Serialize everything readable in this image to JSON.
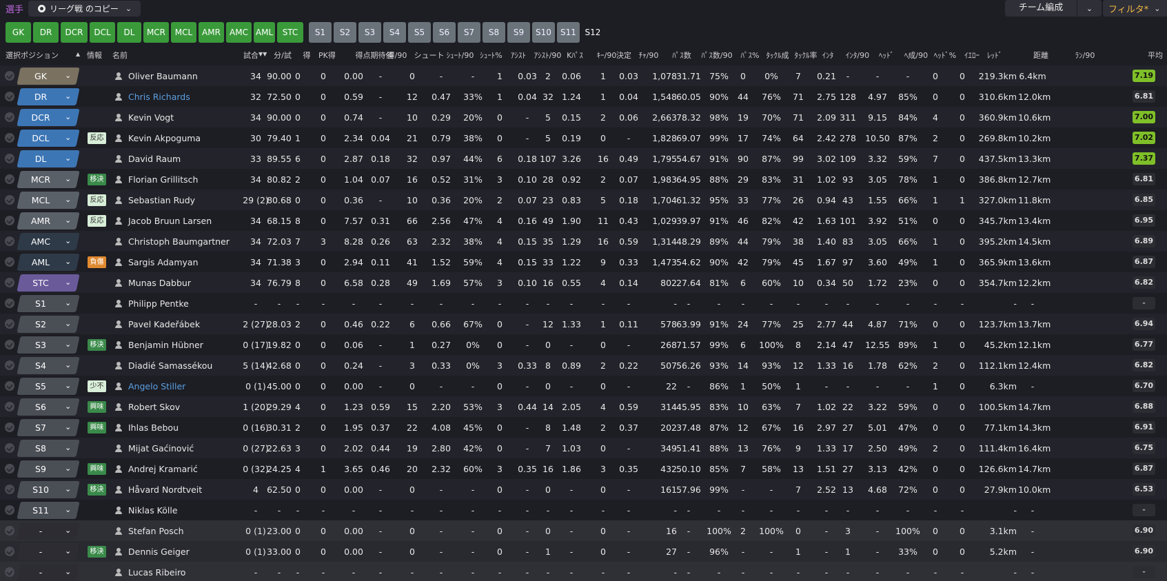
{
  "header": {
    "title": "選手",
    "view_label": "リーグ戦 のコピー",
    "team_button": "チーム編成",
    "filter_button": "フィルタ*"
  },
  "tabs": [
    "GK",
    "DR",
    "DCR",
    "DCL",
    "DL",
    "MCR",
    "MCL",
    "AMR",
    "AMC",
    "AML",
    "STC",
    "S1",
    "S2",
    "S3",
    "S4",
    "S5",
    "S6",
    "S7",
    "S8",
    "S9",
    "S10",
    "S11",
    "S12"
  ],
  "columns": [
    "選択ポジション",
    "情報",
    "名前",
    "試合",
    "分/試",
    "得",
    "PK得",
    "得点期待値",
    "得/90",
    "シュート",
    "ｼｭｰﾄ/90",
    "ｼｭｰﾄ%",
    "ｱｼｽﾄ",
    "ｱｼｽﾄ/90",
    "Kﾊﾟｽ",
    "ｷｰ/90",
    "決定",
    "ﾁｬ/90",
    "ﾊﾟｽ数",
    "ﾊﾟｽ数/90",
    "ﾊﾟｽ%",
    "ﾀｯｸﾙ成",
    "ﾀｯｸﾙ率",
    "ｲﾝﾀ",
    "ｲﾝﾀ/90",
    "ﾍｯﾄﾞ",
    "ﾍ成/90",
    "ﾍｯﾄﾞ%",
    "ｲｴﾛｰ",
    "ﾚｯﾄﾞ",
    "距離",
    "ﾗﾝ/90",
    "平均"
  ],
  "rows": [
    {
      "pos": "GK",
      "role": "",
      "name": "Oliver Baumann",
      "link": false,
      "bench": false,
      "rating": "7.19",
      "rc": "green",
      "stats": [
        "34",
        "90.00",
        "0",
        "0",
        "0.00",
        "-",
        "0",
        "-",
        "-",
        "1",
        "0.03",
        "2",
        "0.06",
        "1",
        "0.03",
        "1,078",
        "31.71",
        "75%",
        "0",
        "0%",
        "7",
        "0.21",
        "-",
        "-",
        "-",
        "0",
        "0",
        "219.3km",
        "6.4km"
      ]
    },
    {
      "pos": "DR",
      "role": "",
      "name": "Chris Richards",
      "link": true,
      "bench": false,
      "rating": "6.81",
      "rc": "grey",
      "stats": [
        "32",
        "72.50",
        "0",
        "0",
        "0.59",
        "-",
        "12",
        "0.47",
        "33%",
        "1",
        "0.04",
        "32",
        "1.24",
        "1",
        "0.04",
        "1,548",
        "60.05",
        "90%",
        "44",
        "76%",
        "71",
        "2.75",
        "128",
        "4.97",
        "85%",
        "0",
        "0",
        "310.6km",
        "12.0km"
      ]
    },
    {
      "pos": "DCR",
      "role": "",
      "name": "Kevin Vogt",
      "link": false,
      "bench": false,
      "rating": "7.00",
      "rc": "green",
      "stats": [
        "34",
        "90.00",
        "0",
        "0",
        "0.74",
        "-",
        "10",
        "0.29",
        "20%",
        "0",
        "-",
        "5",
        "0.15",
        "2",
        "0.06",
        "2,663",
        "78.32",
        "98%",
        "19",
        "70%",
        "71",
        "2.09",
        "311",
        "9.15",
        "84%",
        "4",
        "0",
        "360.9km",
        "10.6km"
      ]
    },
    {
      "pos": "DCL",
      "role": "反応",
      "name": "Kevin Akpoguma",
      "link": false,
      "bench": false,
      "rating": "7.02",
      "rc": "green",
      "stats": [
        "30",
        "79.40",
        "1",
        "0",
        "2.34",
        "0.04",
        "21",
        "0.79",
        "38%",
        "0",
        "-",
        "5",
        "0.19",
        "0",
        "-",
        "1,828",
        "69.07",
        "99%",
        "17",
        "74%",
        "64",
        "2.42",
        "278",
        "10.50",
        "87%",
        "2",
        "0",
        "269.8km",
        "10.2km"
      ]
    },
    {
      "pos": "DL",
      "role": "",
      "name": "David Raum",
      "link": false,
      "bench": false,
      "rating": "7.37",
      "rc": "green",
      "stats": [
        "33",
        "89.55",
        "6",
        "0",
        "2.87",
        "0.18",
        "32",
        "0.97",
        "44%",
        "6",
        "0.18",
        "107",
        "3.26",
        "16",
        "0.49",
        "1,795",
        "54.67",
        "91%",
        "90",
        "87%",
        "99",
        "3.02",
        "109",
        "3.32",
        "59%",
        "7",
        "0",
        "437.5km",
        "13.3km"
      ]
    },
    {
      "pos": "MCR",
      "role": "移決",
      "name": "Florian Grillitsch",
      "link": false,
      "bench": false,
      "rating": "6.81",
      "rc": "grey",
      "stats": [
        "34",
        "80.82",
        "2",
        "0",
        "1.04",
        "0.07",
        "16",
        "0.52",
        "31%",
        "3",
        "0.10",
        "28",
        "0.92",
        "2",
        "0.07",
        "1,983",
        "64.95",
        "88%",
        "29",
        "83%",
        "31",
        "1.02",
        "93",
        "3.05",
        "78%",
        "1",
        "0",
        "386.8km",
        "12.7km"
      ]
    },
    {
      "pos": "MCL",
      "role": "反応",
      "name": "Sebastian Rudy",
      "link": false,
      "bench": false,
      "rating": "6.85",
      "rc": "grey",
      "stats": [
        "29 (2)",
        "80.68",
        "0",
        "0",
        "0.36",
        "-",
        "10",
        "0.36",
        "20%",
        "2",
        "0.07",
        "23",
        "0.83",
        "5",
        "0.18",
        "1,704",
        "61.32",
        "95%",
        "33",
        "77%",
        "26",
        "0.94",
        "43",
        "1.55",
        "66%",
        "1",
        "1",
        "327.0km",
        "11.8km"
      ]
    },
    {
      "pos": "AMR",
      "role": "反応",
      "name": "Jacob Bruun Larsen",
      "link": false,
      "bench": false,
      "rating": "6.95",
      "rc": "grey",
      "stats": [
        "34",
        "68.15",
        "8",
        "0",
        "7.57",
        "0.31",
        "66",
        "2.56",
        "47%",
        "4",
        "0.16",
        "49",
        "1.90",
        "11",
        "0.43",
        "1,029",
        "39.97",
        "91%",
        "46",
        "82%",
        "42",
        "1.63",
        "101",
        "3.92",
        "51%",
        "0",
        "0",
        "345.7km",
        "13.4km"
      ]
    },
    {
      "pos": "AMC",
      "role": "",
      "name": "Christoph Baumgartner",
      "link": false,
      "bench": false,
      "rating": "6.89",
      "rc": "grey",
      "stats": [
        "34",
        "72.03",
        "7",
        "3",
        "8.28",
        "0.26",
        "63",
        "2.32",
        "38%",
        "4",
        "0.15",
        "35",
        "1.29",
        "16",
        "0.59",
        "1,314",
        "48.29",
        "89%",
        "44",
        "79%",
        "38",
        "1.40",
        "83",
        "3.05",
        "66%",
        "1",
        "0",
        "395.2km",
        "14.5km"
      ]
    },
    {
      "pos": "AML",
      "role": "負傷",
      "name": "Sargis Adamyan",
      "link": false,
      "bench": false,
      "rating": "6.87",
      "rc": "grey",
      "stats": [
        "34",
        "71.38",
        "3",
        "0",
        "2.94",
        "0.11",
        "41",
        "1.52",
        "59%",
        "4",
        "0.15",
        "33",
        "1.22",
        "9",
        "0.33",
        "1,473",
        "54.62",
        "90%",
        "42",
        "79%",
        "45",
        "1.67",
        "97",
        "3.60",
        "49%",
        "1",
        "0",
        "365.9km",
        "13.6km"
      ]
    },
    {
      "pos": "STC",
      "role": "",
      "name": "Munas Dabbur",
      "link": false,
      "bench": false,
      "rating": "6.82",
      "rc": "grey",
      "stats": [
        "34",
        "76.79",
        "8",
        "0",
        "6.58",
        "0.28",
        "49",
        "1.69",
        "57%",
        "3",
        "0.10",
        "16",
        "0.55",
        "4",
        "0.14",
        "802",
        "27.64",
        "81%",
        "6",
        "60%",
        "10",
        "0.34",
        "50",
        "1.72",
        "23%",
        "0",
        "0",
        "354.7km",
        "12.2km"
      ]
    },
    {
      "pos": "S1",
      "role": "",
      "name": "Philipp Pentke",
      "link": false,
      "bench": false,
      "rating": "-",
      "rc": "dash",
      "stats": [
        "-",
        "-",
        "-",
        "-",
        "-",
        "-",
        "-",
        "-",
        "-",
        "-",
        "-",
        "-",
        "-",
        "-",
        "-",
        "-",
        "-",
        "-",
        "-",
        "-",
        "-",
        "-",
        "-",
        "-",
        "-",
        "-",
        "-",
        "-",
        "-"
      ]
    },
    {
      "pos": "S2",
      "role": "",
      "name": "Pavel Kadeřábek",
      "link": false,
      "bench": false,
      "rating": "6.94",
      "rc": "grey",
      "stats": [
        "2 (27)",
        "28.03",
        "2",
        "0",
        "0.46",
        "0.22",
        "6",
        "0.66",
        "67%",
        "0",
        "-",
        "12",
        "1.33",
        "1",
        "0.11",
        "578",
        "63.99",
        "91%",
        "24",
        "77%",
        "25",
        "2.77",
        "44",
        "4.87",
        "71%",
        "0",
        "0",
        "123.7km",
        "13.7km"
      ]
    },
    {
      "pos": "S3",
      "role": "移決",
      "name": "Benjamin Hübner",
      "link": false,
      "bench": false,
      "rating": "6.77",
      "rc": "grey",
      "stats": [
        "0 (17)",
        "19.82",
        "0",
        "0",
        "0.06",
        "-",
        "1",
        "0.27",
        "0%",
        "0",
        "-",
        "0",
        "-",
        "0",
        "-",
        "268",
        "71.57",
        "99%",
        "6",
        "100%",
        "8",
        "2.14",
        "47",
        "12.55",
        "89%",
        "1",
        "0",
        "45.2km",
        "12.1km"
      ]
    },
    {
      "pos": "S4",
      "role": "",
      "name": "Diadié Samassékou",
      "link": false,
      "bench": false,
      "rating": "6.82",
      "rc": "grey",
      "stats": [
        "5 (14)",
        "42.68",
        "0",
        "0",
        "0.24",
        "-",
        "3",
        "0.33",
        "0%",
        "3",
        "0.33",
        "8",
        "0.89",
        "2",
        "0.22",
        "507",
        "56.26",
        "93%",
        "14",
        "93%",
        "12",
        "1.33",
        "16",
        "1.78",
        "62%",
        "2",
        "0",
        "112.1km",
        "12.4km"
      ]
    },
    {
      "pos": "S5",
      "role": "少不",
      "name": "Angelo Stiller",
      "link": true,
      "bench": false,
      "rating": "6.70",
      "rc": "grey",
      "stats": [
        "0 (1)",
        "45.00",
        "0",
        "0",
        "0.00",
        "-",
        "0",
        "-",
        "-",
        "0",
        "-",
        "0",
        "-",
        "0",
        "-",
        "22",
        "-",
        "86%",
        "1",
        "50%",
        "1",
        "-",
        "-",
        "-",
        "-",
        "1",
        "0",
        "6.3km",
        "-"
      ]
    },
    {
      "pos": "S6",
      "role": "興味",
      "name": "Robert Skov",
      "link": false,
      "bench": false,
      "rating": "6.88",
      "rc": "grey",
      "stats": [
        "1 (20)",
        "29.29",
        "4",
        "0",
        "1.23",
        "0.59",
        "15",
        "2.20",
        "53%",
        "3",
        "0.44",
        "14",
        "2.05",
        "4",
        "0.59",
        "314",
        "45.95",
        "83%",
        "10",
        "63%",
        "7",
        "1.02",
        "22",
        "3.22",
        "59%",
        "0",
        "0",
        "100.5km",
        "14.7km"
      ]
    },
    {
      "pos": "S7",
      "role": "興味",
      "name": "Ihlas Bebou",
      "link": false,
      "bench": false,
      "rating": "6.91",
      "rc": "grey",
      "stats": [
        "0 (16)",
        "30.31",
        "2",
        "0",
        "1.95",
        "0.37",
        "22",
        "4.08",
        "45%",
        "0",
        "-",
        "8",
        "1.48",
        "2",
        "0.37",
        "202",
        "37.48",
        "87%",
        "12",
        "67%",
        "16",
        "2.97",
        "27",
        "5.01",
        "47%",
        "0",
        "0",
        "77.1km",
        "14.3km"
      ]
    },
    {
      "pos": "S8",
      "role": "",
      "name": "Mijat Gaćinović",
      "link": false,
      "bench": false,
      "rating": "6.75",
      "rc": "grey",
      "stats": [
        "0 (27)",
        "22.63",
        "3",
        "0",
        "2.02",
        "0.44",
        "19",
        "2.80",
        "42%",
        "0",
        "-",
        "7",
        "1.03",
        "0",
        "-",
        "349",
        "51.41",
        "88%",
        "13",
        "76%",
        "9",
        "1.33",
        "17",
        "2.50",
        "49%",
        "2",
        "0",
        "111.4km",
        "16.4km"
      ]
    },
    {
      "pos": "S9",
      "role": "興味",
      "name": "Andrej Kramarić",
      "link": false,
      "bench": false,
      "rating": "6.87",
      "rc": "grey",
      "stats": [
        "0 (32)",
        "24.25",
        "4",
        "1",
        "3.65",
        "0.46",
        "20",
        "2.32",
        "60%",
        "3",
        "0.35",
        "16",
        "1.86",
        "3",
        "0.35",
        "432",
        "50.10",
        "85%",
        "7",
        "58%",
        "13",
        "1.51",
        "27",
        "3.13",
        "42%",
        "0",
        "0",
        "126.6km",
        "14.7km"
      ]
    },
    {
      "pos": "S10",
      "role": "移決",
      "name": "Håvard Nordtveit",
      "link": false,
      "bench": false,
      "rating": "6.53",
      "rc": "grey",
      "stats": [
        "4",
        "62.50",
        "0",
        "0",
        "0.00",
        "-",
        "0",
        "-",
        "-",
        "0",
        "-",
        "0",
        "-",
        "0",
        "-",
        "161",
        "57.96",
        "99%",
        "-",
        "-",
        "7",
        "2.52",
        "13",
        "4.68",
        "72%",
        "0",
        "0",
        "27.9km",
        "10.0km"
      ]
    },
    {
      "pos": "S11",
      "role": "",
      "name": "Niklas Kölle",
      "link": false,
      "bench": false,
      "rating": "-",
      "rc": "dash",
      "stats": [
        "-",
        "-",
        "-",
        "-",
        "-",
        "-",
        "-",
        "-",
        "-",
        "-",
        "-",
        "-",
        "-",
        "-",
        "-",
        "-",
        "-",
        "-",
        "-",
        "-",
        "-",
        "-",
        "-",
        "-",
        "-",
        "-",
        "-",
        "-",
        "-"
      ]
    },
    {
      "pos": "-",
      "role": "",
      "name": "Stefan Posch",
      "link": false,
      "bench": true,
      "rating": "6.90",
      "rc": "grey",
      "stats": [
        "0 (1)",
        "23.00",
        "0",
        "0",
        "0.00",
        "-",
        "0",
        "-",
        "-",
        "0",
        "-",
        "0",
        "-",
        "0",
        "-",
        "16",
        "-",
        "100%",
        "2",
        "100%",
        "0",
        "-",
        "3",
        "-",
        "100%",
        "0",
        "0",
        "3.1km",
        "-"
      ]
    },
    {
      "pos": "-",
      "role": "移決",
      "name": "Dennis Geiger",
      "link": false,
      "bench": true,
      "rating": "6.90",
      "rc": "grey",
      "stats": [
        "0 (1)",
        "33.00",
        "0",
        "0",
        "0.00",
        "-",
        "0",
        "-",
        "-",
        "0",
        "-",
        "1",
        "-",
        "0",
        "-",
        "27",
        "-",
        "96%",
        "-",
        "-",
        "1",
        "-",
        "1",
        "-",
        "33%",
        "0",
        "0",
        "5.2km",
        "-"
      ]
    },
    {
      "pos": "-",
      "role": "",
      "name": "Lucas Ribeiro",
      "link": false,
      "bench": true,
      "rating": "-",
      "rc": "dash",
      "stats": [
        "-",
        "-",
        "-",
        "-",
        "-",
        "-",
        "-",
        "-",
        "-",
        "-",
        "-",
        "-",
        "-",
        "-",
        "-",
        "-",
        "-",
        "-",
        "-",
        "-",
        "-",
        "-",
        "-",
        "-",
        "-",
        "-",
        "-",
        "-",
        "-"
      ]
    }
  ],
  "colors": {
    "gk": "#7a7160",
    "def": "#3d76b5",
    "mid": "#5a6068",
    "attmid": "#2e3a48",
    "str": "#6a5a9a",
    "sub": "#4a4e55",
    "bench": "#2c2c32",
    "tab_green": "#3a9a3a",
    "tab_grey": "#6b737a",
    "role_green": "#3a8a4a",
    "role_light": "#d8eed8",
    "role_orange": "#e08a30",
    "rating_green": "#7fbf28",
    "link": "#5aa0e0"
  }
}
